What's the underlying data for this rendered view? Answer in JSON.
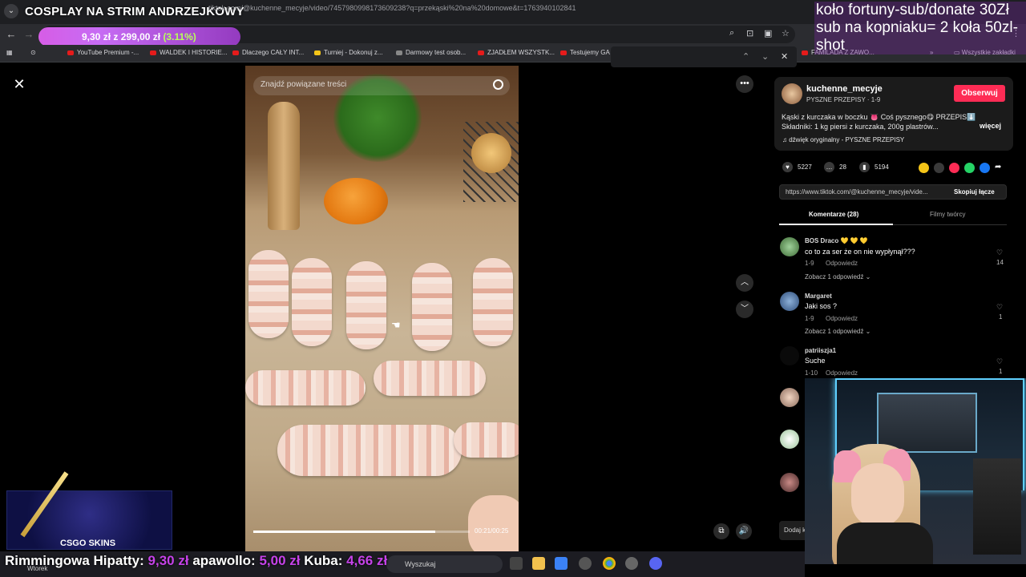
{
  "stream": {
    "title": "COSPLAY NA STRIM ANDRZEJKOWY",
    "goal": {
      "raised": "9,30 zł",
      "separator": "z",
      "target": "299,00 zł",
      "percent": "(3.11%)",
      "progress": 0.0311
    },
    "overlay_message": "koło fortuny-sub/donate 30Zł sub na kopniaku= 2 koła 50zl-shot"
  },
  "browser": {
    "url": "tiktok.com/@kuchenne_mecyje/video/7457980998173609238?q=przekąski%20na%20domowe&t=1763940102841",
    "bookmarks": [
      "YouTube Premium -...",
      "WALDEK I HISTORIE...",
      "Dlaczego CAŁY INT...",
      "Turniej - Dokonuj z...",
      "Darmowy test osob...",
      "ZJADŁEM WSZYSTK...",
      "Testujemy GA",
      "FAMILADA Z ZAWO...",
      "Wszystkie zakładki"
    ]
  },
  "video": {
    "search_placeholder": "Znajdź powiązane treści",
    "time": "00:21/00:25",
    "progress": 0.84
  },
  "creator": {
    "username": "kuchenne_mecyje",
    "subname": "PYSZNE PRZEPISY · 1-9",
    "follow_label": "Obserwuj",
    "description": "Kąski z kurczaka w boczku 👅 Coś pysznego😋 PRZEPIS⬇️ Składniki: 1 kg piersi z kurczaka, 200g plastrów...",
    "more_label": "więcej",
    "sound": "♫  dźwięk oryginalny - PYSZNE PRZEPISY"
  },
  "stats": {
    "likes": "5227",
    "comments": "28",
    "saves": "5194"
  },
  "link": {
    "url": "https://www.tiktok.com/@kuchenne_mecyje/vide...",
    "copy_label": "Skopiuj łącze"
  },
  "tabs": {
    "comments": "Komentarze (28)",
    "videos": "Filmy twórcy"
  },
  "comments": [
    {
      "user": "BOS Draco 💛 💛 💛",
      "text": "co to za ser że on nie wypłynął???",
      "date": "1-9",
      "reply": "Odpowiedz",
      "more": "Zobacz 1 odpowiedź ⌄",
      "likes": "14"
    },
    {
      "user": "Margaret",
      "text": "Jaki sos ?",
      "date": "1-9",
      "reply": "Odpowiedz",
      "more": "Zobacz 1 odpowiedź ⌄",
      "likes": "1"
    },
    {
      "user": "patriiszja1",
      "text": "Suche",
      "date": "1-10",
      "reply": "Odpowiedz",
      "more": "",
      "likes": "1"
    }
  ],
  "add_comment": "Dodaj k",
  "ad": {
    "logo": "CSGO SKINS"
  },
  "ticker": [
    {
      "name": "Rimmingowa Hipatty:",
      "amount": "9,30 zł"
    },
    {
      "name": "apawollo:",
      "amount": "5,00 zł"
    },
    {
      "name": "Kuba:",
      "amount": "4,66 zł"
    }
  ],
  "taskbar": {
    "day": "Wtorek",
    "search_placeholder": "Wyszukaj"
  },
  "colors": {
    "follow": "#fe2c55",
    "ticker_amount": "#c542e8",
    "goal_percent": "#b8ff5a"
  }
}
